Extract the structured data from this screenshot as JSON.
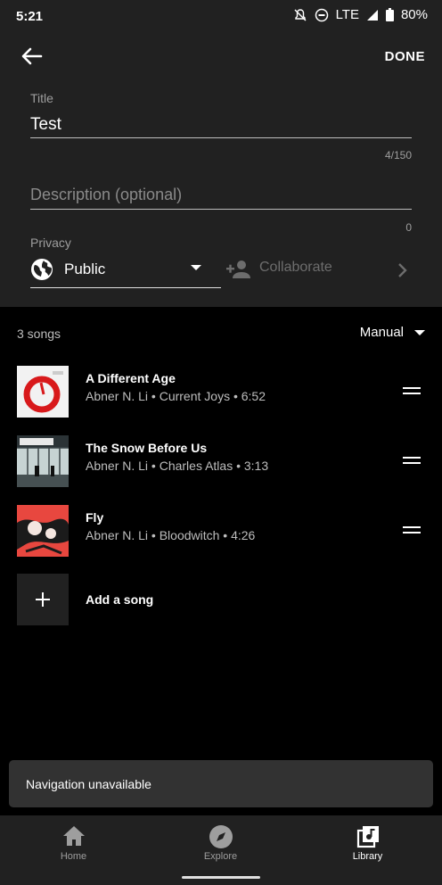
{
  "status_bar": {
    "time": "5:21",
    "network": "LTE",
    "battery": "80%"
  },
  "header": {
    "done_label": "DONE"
  },
  "form": {
    "title_label": "Title",
    "title_value": "Test",
    "title_counter": "4/150",
    "description_placeholder": "Description (optional)",
    "description_counter": "0",
    "privacy_label": "Privacy",
    "privacy_value": "Public",
    "collaborate_label": "Collaborate"
  },
  "playlist": {
    "count_label": "3 songs",
    "sort_label": "Manual",
    "songs": [
      {
        "title": "A Different Age",
        "subtitle": "Abner N. Li • Current Joys • 6:52"
      },
      {
        "title": "The Snow Before Us",
        "subtitle": "Abner N. Li • Charles Atlas • 3:13"
      },
      {
        "title": "Fly",
        "subtitle": "Abner N. Li • Bloodwitch • 4:26"
      }
    ],
    "add_label": "Add a song"
  },
  "snackbar": {
    "message": "Navigation unavailable"
  },
  "bottom_nav": {
    "tabs": [
      {
        "label": "Home",
        "icon": "home-icon"
      },
      {
        "label": "Explore",
        "icon": "compass-icon"
      },
      {
        "label": "Library",
        "icon": "library-music-icon"
      }
    ],
    "active": "Library"
  },
  "colors": {
    "background": "#000000",
    "surface": "#212121",
    "snackbar": "#323232",
    "muted_text": "#9e9e9e"
  }
}
